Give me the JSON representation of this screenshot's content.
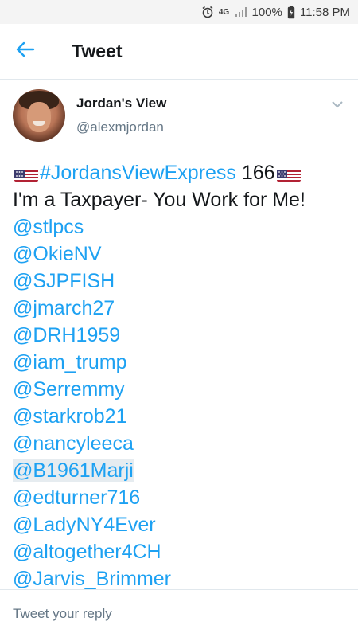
{
  "status_bar": {
    "network": "4G",
    "battery": "100%",
    "time": "11:58 PM"
  },
  "header": {
    "back_icon": "arrow-left-icon",
    "title": "Tweet"
  },
  "tweet": {
    "author_name": "Jordan's View",
    "author_handle": "@alexmjordan",
    "hashtag": "#JordansViewExpress",
    "number": "166",
    "subtitle": "I'm a Taxpayer- You Work for Me!",
    "mentions": [
      "@stlpcs",
      "@OkieNV",
      "@SJPFISH",
      "@jmarch27",
      "@DRH1959",
      "@iam_trump",
      "@Serremmy",
      "@starkrob21",
      "@nancyleeca",
      "@B1961Marji",
      "@edturner716",
      "@LadyNY4Ever",
      "@altogether4CH",
      "@Jarvis_Brimmer"
    ]
  },
  "reply": {
    "placeholder": "Tweet your reply"
  },
  "colors": {
    "accent": "#1da1f2",
    "text": "#14171a",
    "muted": "#657786"
  }
}
